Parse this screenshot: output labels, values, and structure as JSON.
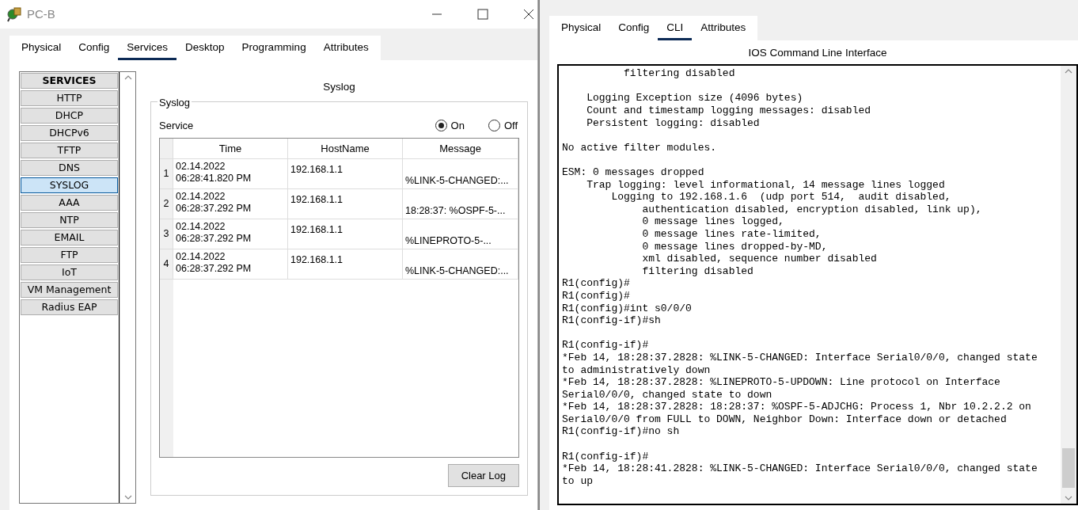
{
  "left_window": {
    "title": "PC-B",
    "tabs": [
      {
        "label": "Physical",
        "selected": false
      },
      {
        "label": "Config",
        "selected": false
      },
      {
        "label": "Services",
        "selected": true
      },
      {
        "label": "Desktop",
        "selected": false
      },
      {
        "label": "Programming",
        "selected": false
      },
      {
        "label": "Attributes",
        "selected": false
      }
    ],
    "sidebar": {
      "header": "SERVICES",
      "items": [
        {
          "label": "HTTP",
          "selected": false
        },
        {
          "label": "DHCP",
          "selected": false
        },
        {
          "label": "DHCPv6",
          "selected": false
        },
        {
          "label": "TFTP",
          "selected": false
        },
        {
          "label": "DNS",
          "selected": false
        },
        {
          "label": "SYSLOG",
          "selected": true
        },
        {
          "label": "AAA",
          "selected": false
        },
        {
          "label": "NTP",
          "selected": false
        },
        {
          "label": "EMAIL",
          "selected": false
        },
        {
          "label": "FTP",
          "selected": false
        },
        {
          "label": "IoT",
          "selected": false
        },
        {
          "label": "VM Management",
          "selected": false
        },
        {
          "label": "Radius EAP",
          "selected": false
        }
      ]
    },
    "panel_title": "Syslog",
    "group_title": "Syslog",
    "service": {
      "label": "Service",
      "options": [
        {
          "label": "On",
          "selected": true
        },
        {
          "label": "Off",
          "selected": false
        }
      ]
    },
    "table": {
      "columns": [
        "Time",
        "HostName",
        "Message"
      ],
      "rows": [
        {
          "index": "1",
          "time": "02.14.2022\n06:28:41.820 PM",
          "host": "192.168.1.1",
          "message": "%LINK-5-CHANGED:..."
        },
        {
          "index": "2",
          "time": "02.14.2022\n06:28:37.292 PM",
          "host": "192.168.1.1",
          "message": "18:28:37: %OSPF-5-..."
        },
        {
          "index": "3",
          "time": "02.14.2022\n06:28:37.292 PM",
          "host": "192.168.1.1",
          "message": "%LINEPROTO-5-..."
        },
        {
          "index": "4",
          "time": "02.14.2022\n06:28:37.292 PM",
          "host": "192.168.1.1",
          "message": "%LINK-5-CHANGED:..."
        }
      ]
    },
    "clear_button": "Clear Log"
  },
  "right_window": {
    "tabs": [
      {
        "label": "Physical",
        "selected": false
      },
      {
        "label": "Config",
        "selected": false
      },
      {
        "label": "CLI",
        "selected": true
      },
      {
        "label": "Attributes",
        "selected": false
      }
    ],
    "cli_title": "IOS Command Line Interface",
    "cli_output": "          filtering disabled\n\n    Logging Exception size (4096 bytes)\n    Count and timestamp logging messages: disabled\n    Persistent logging: disabled\n\nNo active filter modules.\n\nESM: 0 messages dropped\n    Trap logging: level informational, 14 message lines logged\n        Logging to 192.168.1.6  (udp port 514,  audit disabled,\n             authentication disabled, encryption disabled, link up),\n             0 message lines logged,\n             0 message lines rate-limited,\n             0 message lines dropped-by-MD,\n             xml disabled, sequence number disabled\n             filtering disabled\nR1(config)#\nR1(config)#\nR1(config)#int s0/0/0\nR1(config-if)#sh\n\nR1(config-if)#\n*Feb 14, 18:28:37.2828: %LINK-5-CHANGED: Interface Serial0/0/0, changed state\nto administratively down\n*Feb 14, 18:28:37.2828: %LINEPROTO-5-UPDOWN: Line protocol on Interface\nSerial0/0/0, changed state to down\n*Feb 14, 18:28:37.2828: 18:28:37: %OSPF-5-ADJCHG: Process 1, Nbr 10.2.2.2 on\nSerial0/0/0 from FULL to DOWN, Neighbor Down: Interface down or detached\nR1(config-if)#no sh\n\nR1(config-if)#\n*Feb 14, 18:28:41.2828: %LINK-5-CHANGED: Interface Serial0/0/0, changed state\nto up"
  }
}
